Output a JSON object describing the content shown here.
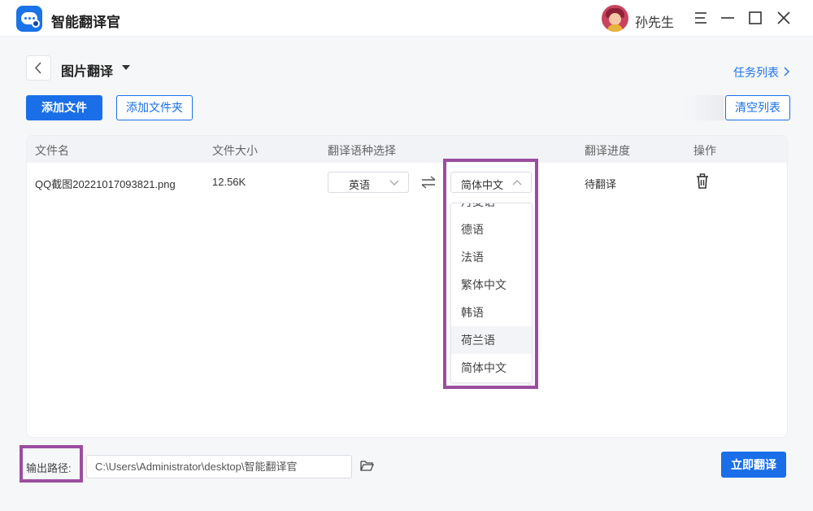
{
  "app": {
    "title": "智能翻译官"
  },
  "user": {
    "name": "孙先生"
  },
  "page": {
    "title": "图片翻译",
    "task_list_label": "任务列表"
  },
  "toolbar": {
    "add_file": "添加文件",
    "add_folder": "添加文件夹",
    "clear_list": "清空列表"
  },
  "table": {
    "columns": [
      "文件名",
      "文件大小",
      "翻译语种选择",
      "翻译进度",
      "操作"
    ],
    "rows": [
      {
        "file_name": "QQ截图20221017093821.png",
        "file_size": "12.56K",
        "source_lang": "英语",
        "target_lang": "简体中文",
        "progress": "待翻译"
      }
    ]
  },
  "language_dropdown": {
    "partial_item": "丹麦语",
    "items": [
      "德语",
      "法语",
      "繁体中文",
      "韩语",
      "荷兰语",
      "简体中文"
    ],
    "hovered_item": "荷兰语"
  },
  "output": {
    "label": "输出路径:",
    "path": "C:\\Users\\Administrator\\desktop\\智能翻译官"
  },
  "actions": {
    "translate_now": "立即翻译"
  },
  "colors": {
    "accent": "#1a6fe8",
    "highlight": "#9b4ea0",
    "background": "#f6f7f9"
  }
}
